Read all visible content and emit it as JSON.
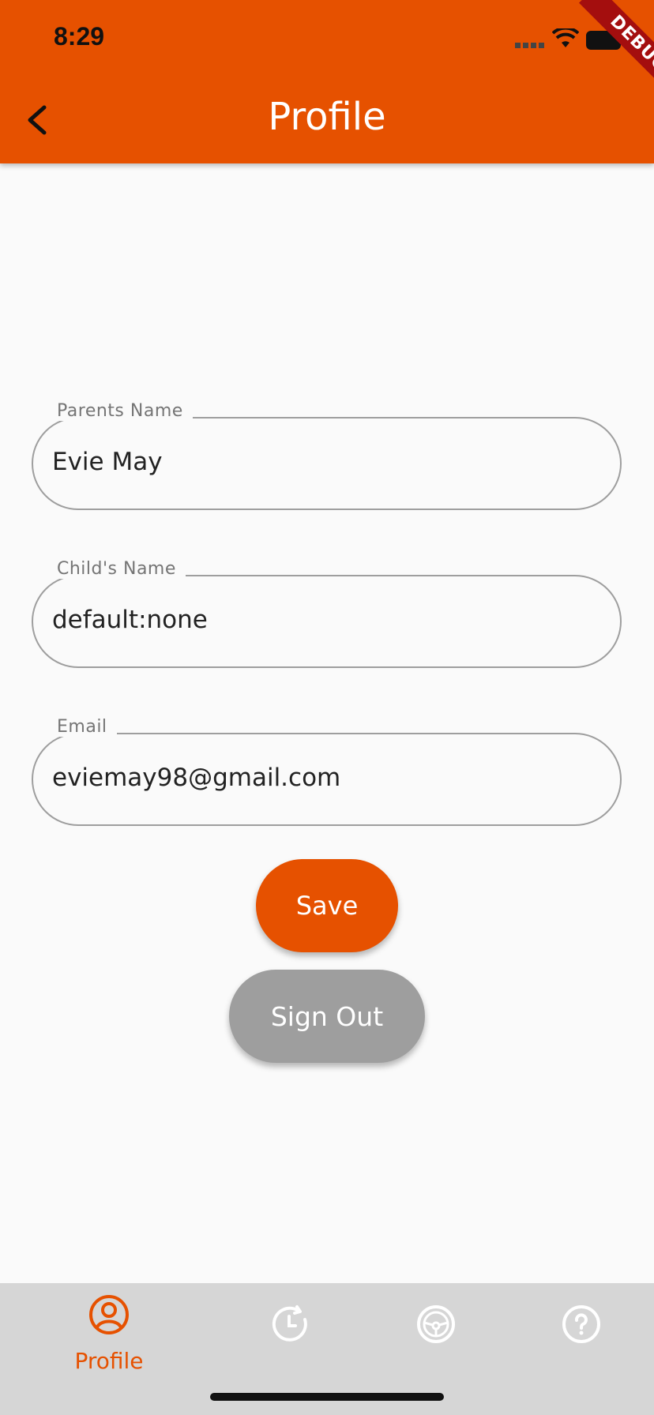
{
  "status_bar": {
    "time": "8:29"
  },
  "app_bar": {
    "title": "Profile",
    "debug_banner": "DEBUG"
  },
  "form": {
    "parents_name": {
      "label": "Parents Name",
      "value": "Evie May"
    },
    "childs_name": {
      "label": "Child's Name",
      "value": "default:none"
    },
    "email": {
      "label": "Email",
      "value": "eviemay98@gmail.com"
    }
  },
  "buttons": {
    "save": "Save",
    "sign_out": "Sign Out"
  },
  "bottom_nav": {
    "items": [
      {
        "label": "Profile",
        "icon": "profile-icon",
        "active": true
      },
      {
        "label": "",
        "icon": "history-icon",
        "active": false
      },
      {
        "label": "",
        "icon": "steering-wheel-icon",
        "active": false
      },
      {
        "label": "",
        "icon": "help-icon",
        "active": false
      }
    ]
  },
  "colors": {
    "accent": "#e65100",
    "inactive_button": "#9e9e9e",
    "nav_bg": "#d6d6d6"
  }
}
